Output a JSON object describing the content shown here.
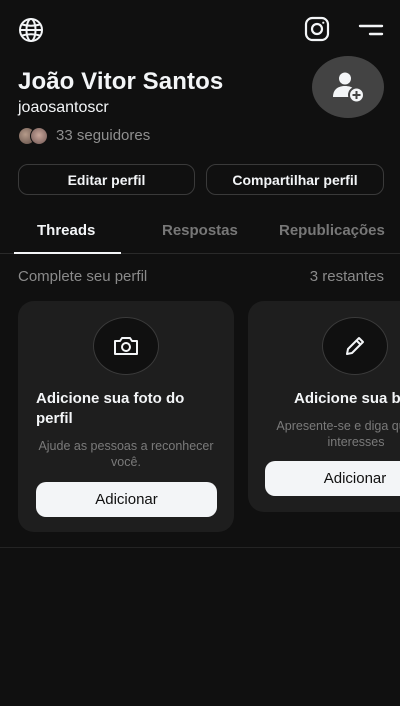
{
  "topbar": {
    "left_icon": "globe-icon",
    "right_icons": [
      "instagram-icon",
      "menu-icon"
    ]
  },
  "profile": {
    "name": "João Vitor Santos",
    "handle": "joaosantoscr",
    "followers_text": "33 seguidores",
    "avatar_icon": "add-person-icon"
  },
  "actions": {
    "edit_label": "Editar perfil",
    "share_label": "Compartilhar perfil"
  },
  "tabs": [
    {
      "label": "Threads",
      "active": true
    },
    {
      "label": "Respostas",
      "active": false
    },
    {
      "label": "Republicações",
      "active": false
    }
  ],
  "complete_profile": {
    "title": "Complete seu perfil",
    "remaining": "3 restantes",
    "cards": [
      {
        "icon": "camera-icon",
        "title": "Adicione sua foto do perfil",
        "description": "Ajude as pessoas a reconhecer você.",
        "button": "Adicionar"
      },
      {
        "icon": "pencil-icon",
        "title": "Adicione sua b",
        "description": "Apresente-se e diga qu seus interesses",
        "button": "Adicionar"
      }
    ]
  },
  "colors": {
    "background": "#101010",
    "card": "#1e1e1e",
    "text": "#f3f5f7",
    "muted": "#8a8a8a"
  }
}
